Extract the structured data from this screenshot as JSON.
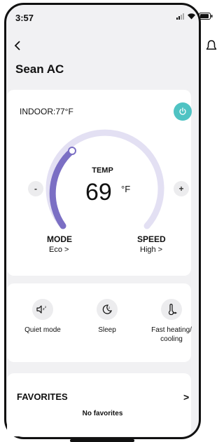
{
  "status": {
    "time": "3:57"
  },
  "header": {
    "title": "Sean AC"
  },
  "controls": {
    "indoor": "INDOOR:77°F",
    "temp_label": "TEMP",
    "temp_value": "69",
    "temp_unit": "°F",
    "minus": "-",
    "plus": "+",
    "mode_label": "MODE",
    "mode_value": "Eco >",
    "speed_label": "SPEED",
    "speed_value": "High >",
    "power_color": "#4fc3c3",
    "dial_accent": "#7b6fc4",
    "dial_track": "#e3e0f3"
  },
  "features": [
    {
      "label": "Quiet mode",
      "icon": "quiet-mode-icon"
    },
    {
      "label": "Sleep",
      "icon": "sleep-icon"
    },
    {
      "label": "Fast heating/ cooling",
      "icon": "fast-heating-icon"
    }
  ],
  "favorites": {
    "title": "FAVORITES",
    "arrow": ">",
    "empty": "No favorites"
  }
}
